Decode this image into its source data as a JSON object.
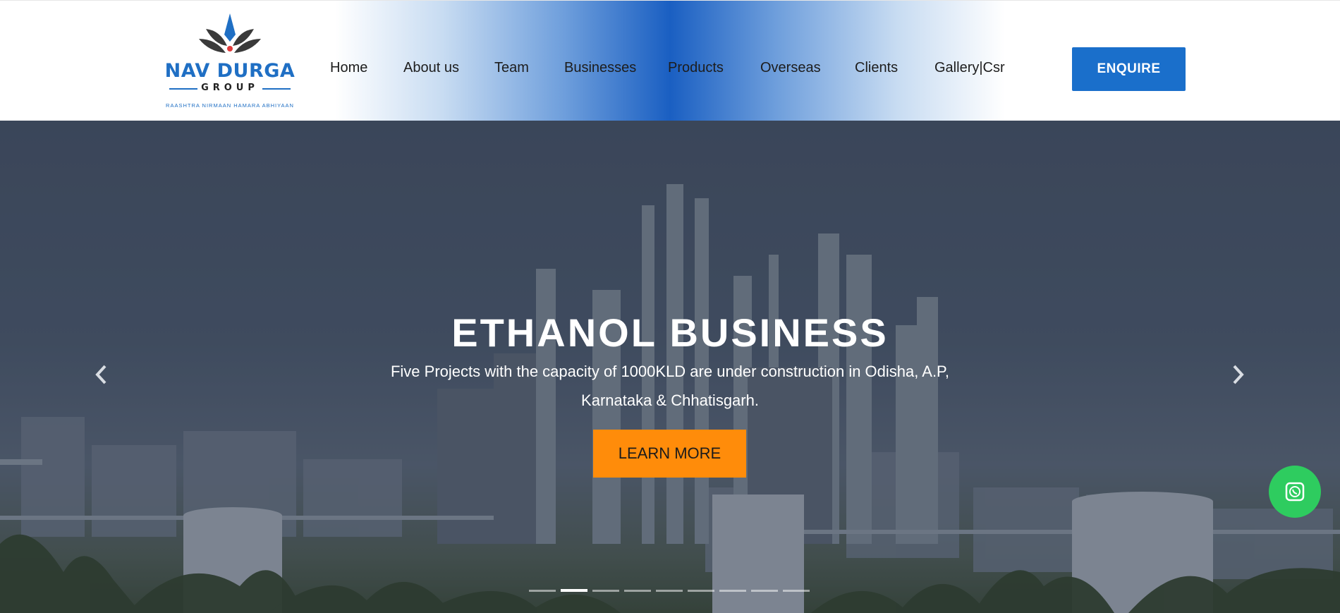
{
  "brand": {
    "name": "NAV DURGA",
    "group": "GROUP",
    "tagline": "RAASHTRA NIRMAAN HAMARA ABHIYAAN",
    "primary_color": "#1f6fc4",
    "accent_color": "#e03a3a"
  },
  "nav": {
    "items": [
      {
        "label": "Home"
      },
      {
        "label": "About us"
      },
      {
        "label": "Team"
      },
      {
        "label": "Businesses"
      },
      {
        "label": "Products"
      },
      {
        "label": "Overseas"
      },
      {
        "label": "Clients"
      },
      {
        "label": "Gallery|Csr"
      }
    ],
    "cta_label": "ENQUIRE",
    "cta_color": "#1a6fcb"
  },
  "hero": {
    "title": "ETHANOL BUSINESS",
    "description_line1": "Five Projects with the capacity of 1000KLD are under construction in Odisha, A.P,",
    "description_line2": "Karnataka & Chhatisgarh.",
    "button_label": "LEARN MORE",
    "button_color": "#ff8c0a",
    "prev_icon": "chevron-left-icon",
    "next_icon": "chevron-right-icon",
    "slide_count": 9,
    "active_slide": 2
  },
  "floating": {
    "whatsapp_icon": "whatsapp-icon",
    "whatsapp_color": "#2ecc5f"
  }
}
